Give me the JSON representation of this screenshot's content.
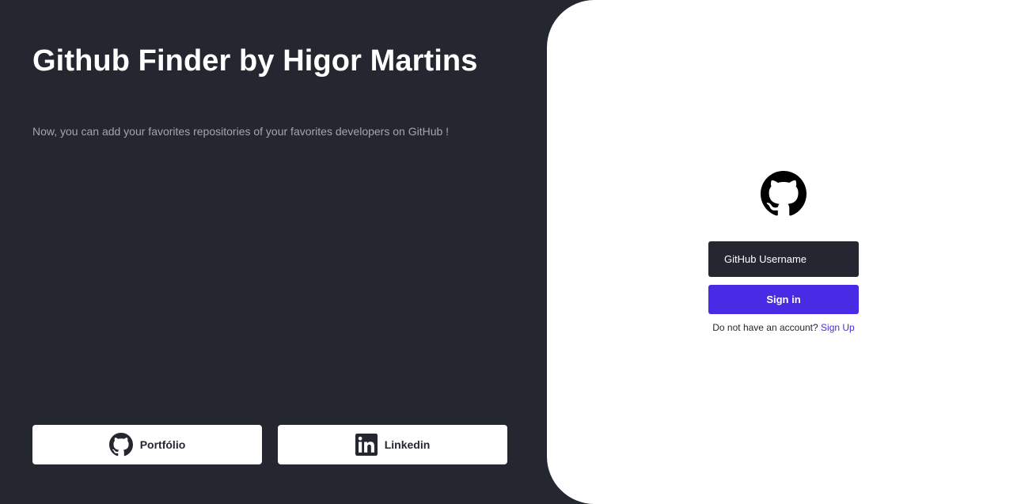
{
  "hero": {
    "title": "Github Finder by Higor Martins",
    "subtitle": "Now, you can add your favorites repositories of your favorites developers on GitHub !"
  },
  "links": {
    "portfolio": {
      "label": "Portfólio",
      "icon": "github-icon"
    },
    "linkedin": {
      "label": "Linkedin",
      "icon": "linkedin-icon"
    }
  },
  "login": {
    "logo_icon": "github-logo-icon",
    "username_placeholder": "GitHub Username",
    "username_value": "",
    "signin_label": "Sign in",
    "signup_prompt": "Do not have an account?",
    "signup_link": "Sign Up"
  },
  "colors": {
    "dark_bg": "#24272f",
    "panel_bg": "#ffffff",
    "accent": "#4a2be5",
    "muted_text": "#a3a6ad"
  }
}
